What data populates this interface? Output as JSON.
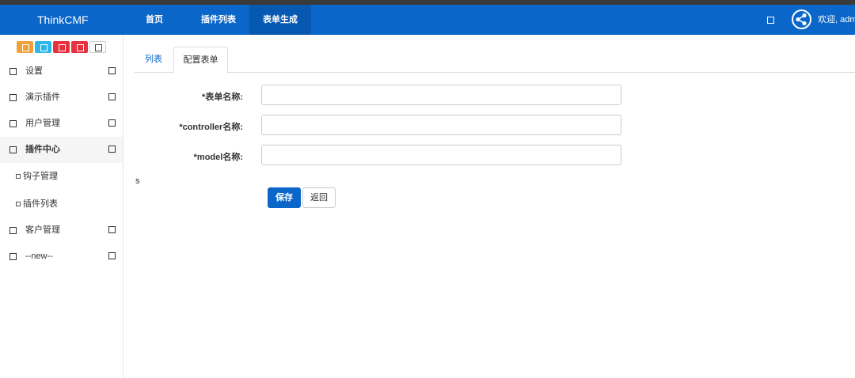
{
  "brand": "ThinkCMF",
  "nav": {
    "items": [
      {
        "label": "首页"
      },
      {
        "label": "插件列表"
      },
      {
        "label": "表单生成"
      }
    ],
    "welcome": "欢迎, admin"
  },
  "sidebar": {
    "swatch_colors": [
      "#f0a13a",
      "#2db7e8",
      "#e8313f",
      "#e8313f",
      "#ffffff"
    ],
    "items": [
      {
        "label": "设置"
      },
      {
        "label": "演示插件"
      },
      {
        "label": "用户管理"
      },
      {
        "label": "插件中心"
      },
      {
        "label": "客户管理"
      },
      {
        "label": "--new--"
      }
    ],
    "sub_items": [
      {
        "label": "钩子管理"
      },
      {
        "label": "插件列表"
      }
    ]
  },
  "tabs": [
    {
      "label": "列表"
    },
    {
      "label": "配置表单"
    }
  ],
  "form": {
    "fields": [
      {
        "label": "*表单名称:",
        "value": ""
      },
      {
        "label": "*controller名称:",
        "value": ""
      },
      {
        "label": "*model名称:",
        "value": ""
      }
    ],
    "stray_text": "s",
    "save_label": "保存",
    "back_label": "返回"
  }
}
